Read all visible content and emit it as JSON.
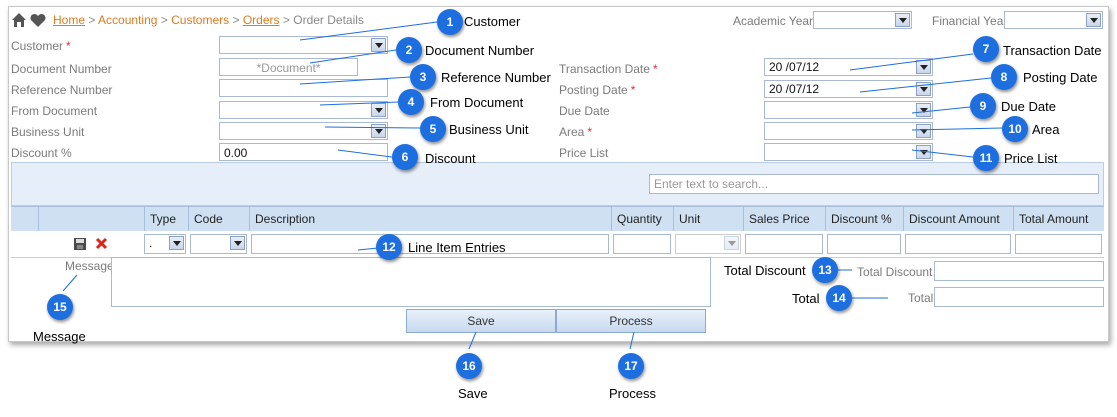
{
  "breadcrumb": {
    "home": "Home",
    "accounting": "Accounting",
    "customers": "Customers",
    "orders": "Orders",
    "current": "Order Details",
    "sep": ">"
  },
  "top": {
    "academic_year": "Academic Year",
    "financial_year": "Financial Year"
  },
  "form": {
    "customer": "Customer",
    "document_number": "Document Number",
    "document_placeholder": "*Document*",
    "reference_number": "Reference Number",
    "from_document": "From Document",
    "business_unit": "Business Unit",
    "discount": "Discount %",
    "discount_value": "0.00",
    "transaction_date": "Transaction Date",
    "transaction_value": "20   /07/12",
    "posting_date": "Posting Date",
    "posting_value": "20   /07/12",
    "due_date": "Due Date",
    "area": "Area",
    "price_list": "Price List",
    "required": "*"
  },
  "grid": {
    "search_placeholder": "Enter text to search...",
    "columns": [
      "Type",
      "Code",
      "Description",
      "Quantity",
      "Unit",
      "Sales Price",
      "Discount %",
      "Discount Amount",
      "Total Amount"
    ],
    "row_type_value": "."
  },
  "footer": {
    "message": "Message",
    "total_discount": "Total Discount",
    "total": "Total",
    "save": "Save",
    "process": "Process"
  },
  "callouts": [
    {
      "n": "1",
      "label": "Customer"
    },
    {
      "n": "2",
      "label": "Document Number"
    },
    {
      "n": "3",
      "label": "Reference Number"
    },
    {
      "n": "4",
      "label": "From Document"
    },
    {
      "n": "5",
      "label": "Business Unit"
    },
    {
      "n": "6",
      "label": "Discount"
    },
    {
      "n": "7",
      "label": "Transaction Date"
    },
    {
      "n": "8",
      "label": "Posting Date"
    },
    {
      "n": "9",
      "label": "Due Date"
    },
    {
      "n": "10",
      "label": "Area"
    },
    {
      "n": "11",
      "label": "Price List"
    },
    {
      "n": "12",
      "label": "Line Item Entries"
    },
    {
      "n": "13",
      "label": "Total Discount"
    },
    {
      "n": "14",
      "label": "Total"
    },
    {
      "n": "15",
      "label": "Message"
    },
    {
      "n": "16",
      "label": "Save"
    },
    {
      "n": "17",
      "label": "Process"
    }
  ],
  "colors": {
    "accent": "#1d6fe0",
    "link": "#e07a1e",
    "header_bg": "#cfe0f3"
  }
}
